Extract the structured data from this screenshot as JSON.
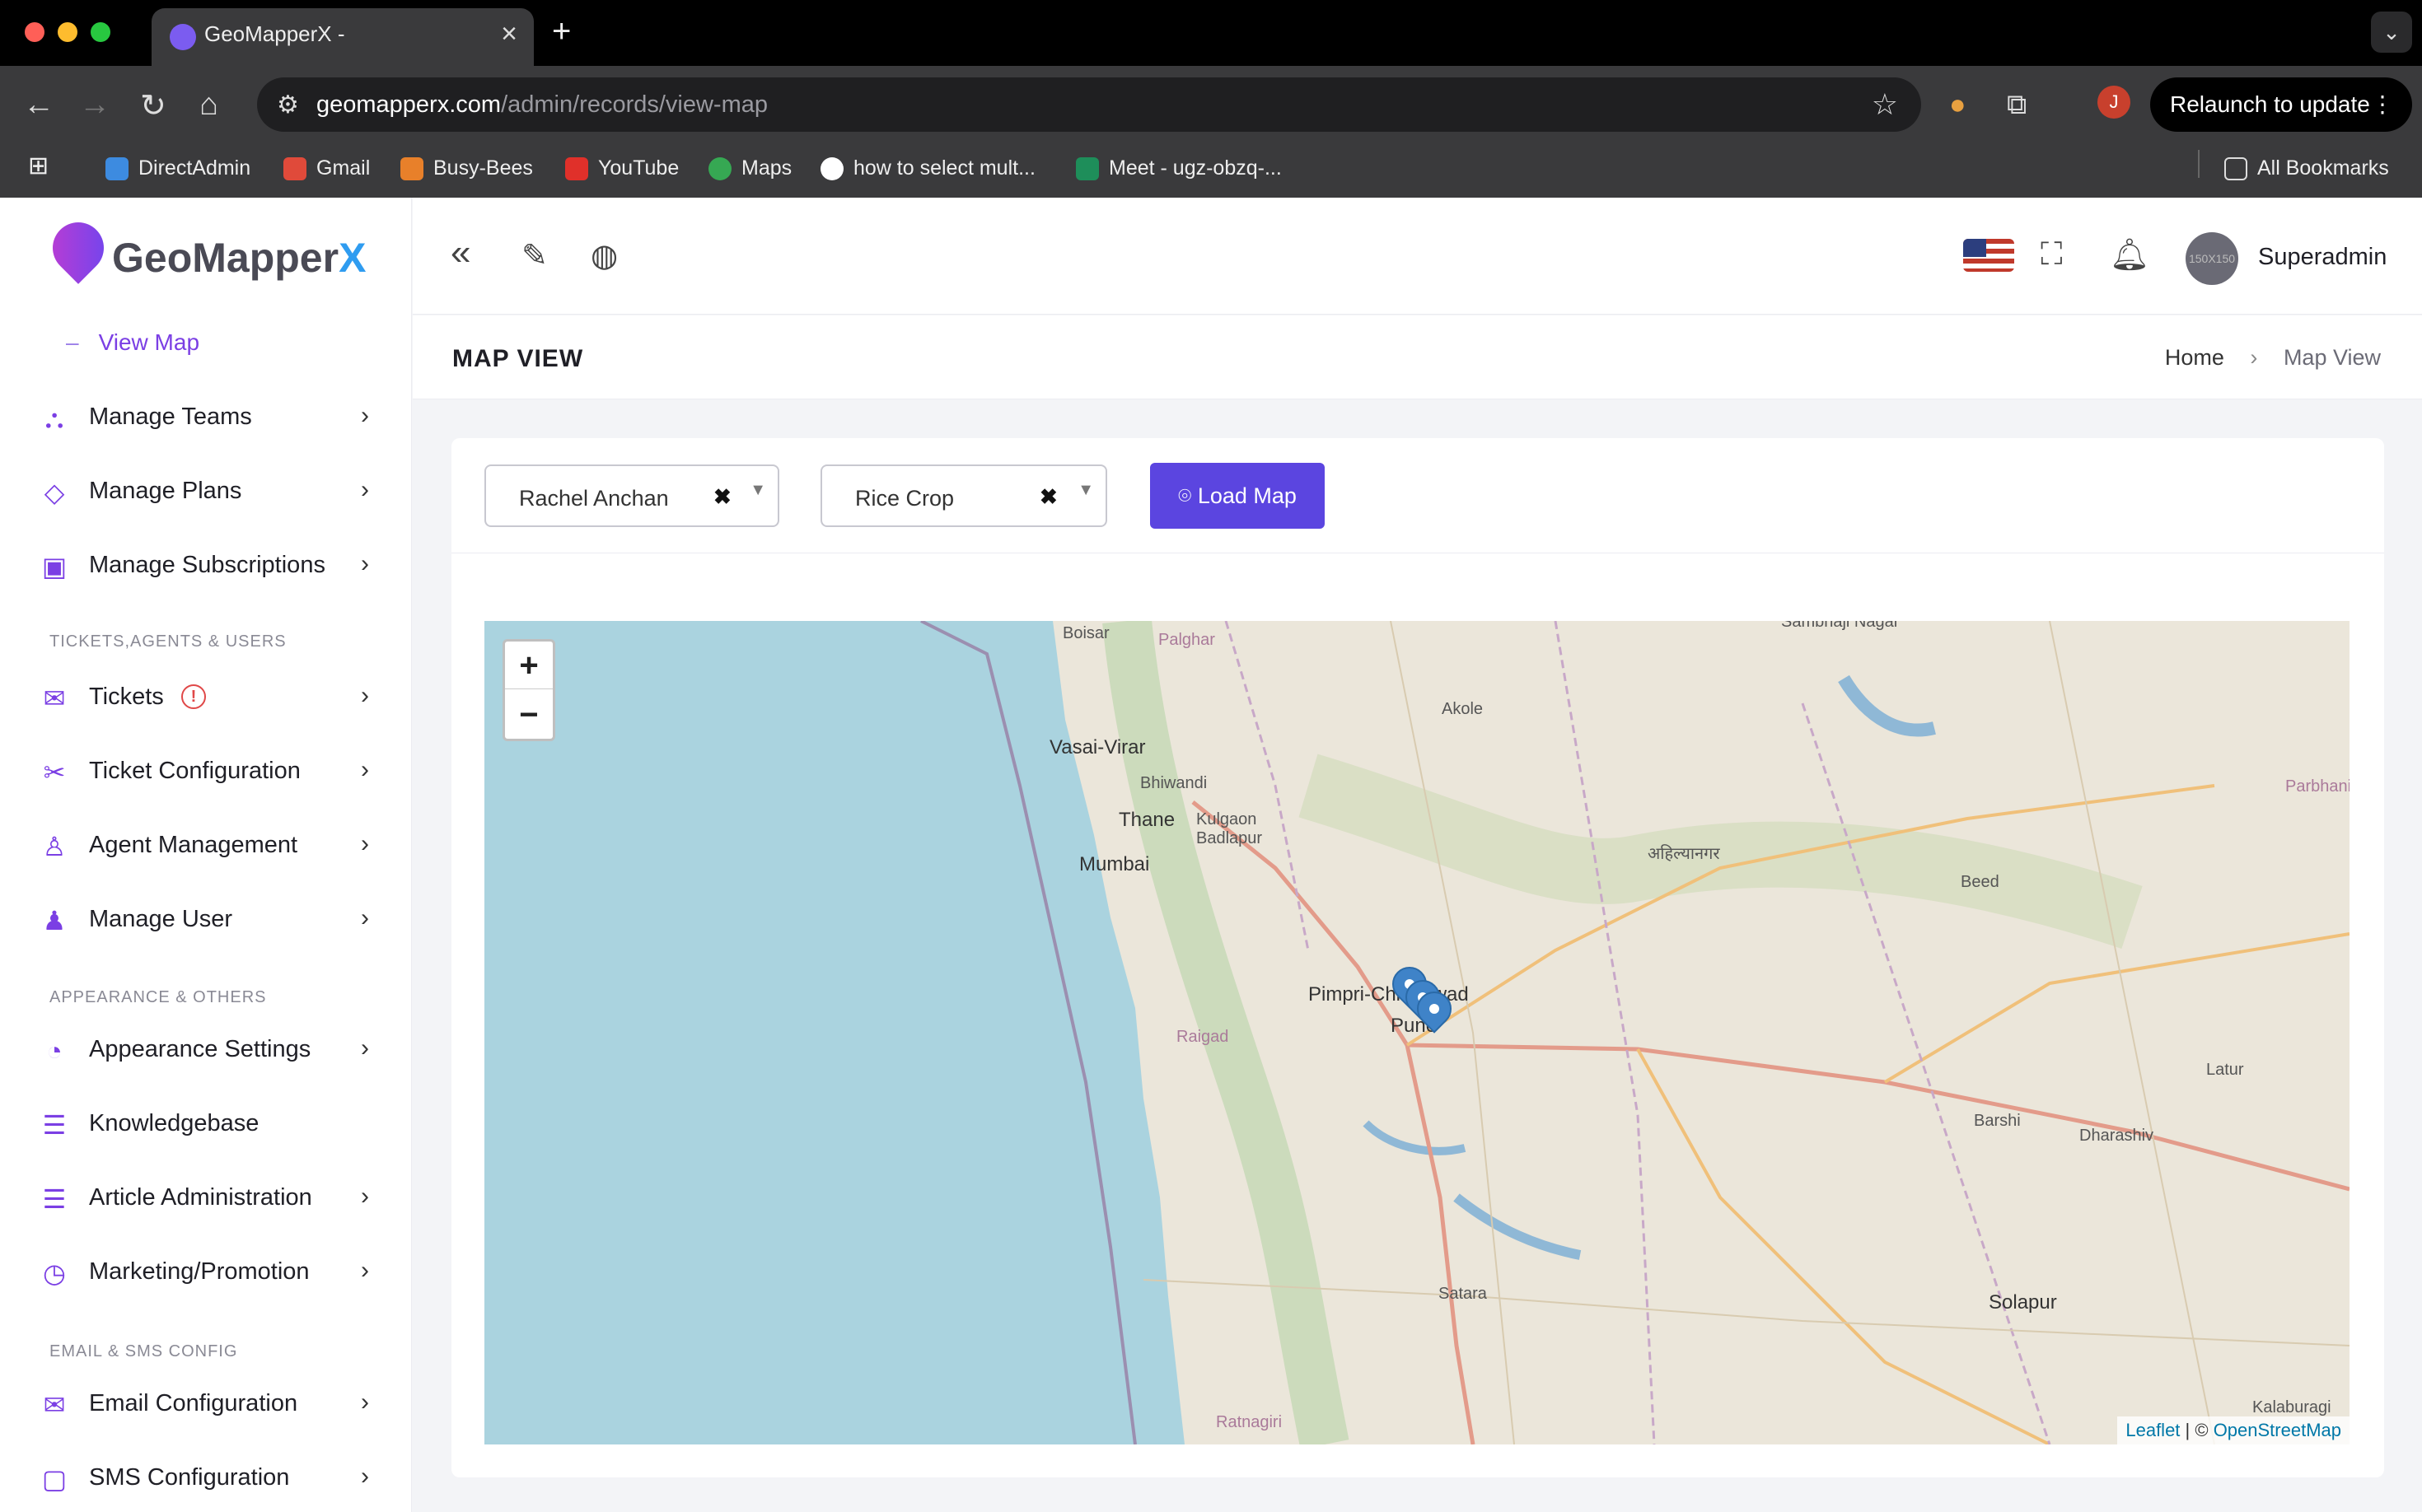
{
  "browser": {
    "tab_title": "GeoMapperX -",
    "url_host": "geomapperx.com",
    "url_path": "/admin/records/view-map",
    "relaunch_label": "Relaunch to update",
    "profile_initial": "J",
    "bookmarks": [
      "DirectAdmin",
      "Gmail",
      "Busy-Bees",
      "YouTube",
      "Maps",
      "how to select mult...",
      "Meet - ugz-obzq-..."
    ],
    "all_bookmarks": "All Bookmarks"
  },
  "sidebar": {
    "logo_main": "GeoMapper",
    "logo_x": "X",
    "sub_item": "View Map",
    "items": [
      {
        "label": "Manage Teams",
        "icon": "teams-icon",
        "chevron": true
      },
      {
        "label": "Manage Plans",
        "icon": "tag-icon",
        "chevron": true
      },
      {
        "label": "Manage Subscriptions",
        "icon": "wallet-icon",
        "chevron": true
      },
      {
        "label": "Tickets",
        "icon": "mail-icon",
        "chevron": true,
        "badge": "!"
      },
      {
        "label": "Ticket Configuration",
        "icon": "tools-icon",
        "chevron": true
      },
      {
        "label": "Agent Management",
        "icon": "user-icon",
        "chevron": true
      },
      {
        "label": "Manage User",
        "icon": "users-icon",
        "chevron": true
      },
      {
        "label": "Appearance Settings",
        "icon": "palette-icon",
        "chevron": true
      },
      {
        "label": "Knowledgebase",
        "icon": "document-icon",
        "chevron": false
      },
      {
        "label": "Article Administration",
        "icon": "document-icon",
        "chevron": true
      },
      {
        "label": "Marketing/Promotion",
        "icon": "chart-icon",
        "chevron": true
      },
      {
        "label": "Email Configuration",
        "icon": "mail-settings-icon",
        "chevron": true
      },
      {
        "label": "SMS Configuration",
        "icon": "sms-icon",
        "chevron": true
      }
    ],
    "sections": [
      "TICKETS,AGENTS & USERS",
      "APPEARANCE & OTHERS",
      "EMAIL & SMS CONFIG"
    ]
  },
  "header": {
    "user_name": "Superadmin",
    "avatar_text": "150X150"
  },
  "page": {
    "title": "MAP VIEW",
    "breadcrumb_home": "Home",
    "breadcrumb_current": "Map View"
  },
  "filters": {
    "user_select": "Rachel Anchan",
    "crop_select": "Rice Crop",
    "load_button": "Load Map"
  },
  "map": {
    "zoom_in": "+",
    "zoom_out": "−",
    "attribution_leaflet": "Leaflet",
    "attribution_sep": " | © ",
    "attribution_osm": "OpenStreetMap",
    "cities": [
      "Boisar",
      "Palghar",
      "Vasai-Virar",
      "Bhiwandi",
      "Thane",
      "Kulgaon Badlapur",
      "Mumbai",
      "Akole",
      "अहिल्यानगर",
      "Beed",
      "Parbhani",
      "Pimpri-Chinchwad",
      "Pune",
      "Raigad",
      "Latur",
      "Barshi",
      "Dharashiv",
      "Solapur",
      "Satara",
      "Ratnagiri",
      "Kalaburagi",
      "Sambhaji Nagar"
    ]
  },
  "colors": {
    "accent": "#5b45e0",
    "sidebar_icon": "#7b3fe4",
    "marker": "#3f83c8"
  }
}
